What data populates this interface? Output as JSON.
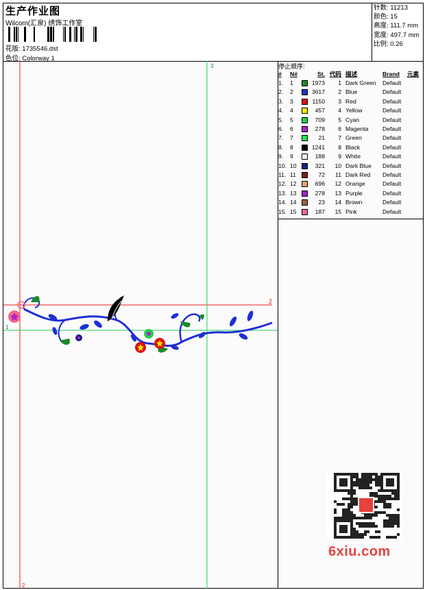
{
  "header": {
    "title": "生产作业图",
    "company": "Wilcom(汇泉) 绣饰工作室",
    "design_label": "花版:",
    "design_value": "1735546.dst",
    "colorway_label": "色位:",
    "colorway_value": "Colorway 1"
  },
  "stats": [
    {
      "label": "针数:",
      "value": "11213"
    },
    {
      "label": "颜色:",
      "value": "15"
    },
    {
      "label": "高度:",
      "value": "111.7 mm"
    },
    {
      "label": "宽度:",
      "value": "497.7 mm"
    },
    {
      "label": "比例:",
      "value": "0.26"
    }
  ],
  "canvas": {
    "marker_1": "1",
    "marker_2": "2",
    "marker_3": "3"
  },
  "color_table": {
    "title": "停止顺序:",
    "headers": {
      "idx": "#",
      "no": "N#",
      "st": "St.",
      "code": "代码",
      "desc": "描述",
      "brand": "Brand",
      "elem": "元素"
    },
    "rows": [
      {
        "idx": "1.",
        "no": "1",
        "color": "#1a8a2a",
        "st": "1973",
        "code": "1",
        "desc": "Dark Green",
        "brand": "Default"
      },
      {
        "idx": "2.",
        "no": "2",
        "color": "#1f2fd6",
        "st": "3617",
        "code": "2",
        "desc": "Blue",
        "brand": "Default"
      },
      {
        "idx": "3.",
        "no": "3",
        "color": "#e01010",
        "st": "1150",
        "code": "3",
        "desc": "Red",
        "brand": "Default"
      },
      {
        "idx": "4.",
        "no": "4",
        "color": "#f2e600",
        "st": "457",
        "code": "4",
        "desc": "Yellow",
        "brand": "Default"
      },
      {
        "idx": "5.",
        "no": "5",
        "color": "#22d04a",
        "st": "709",
        "code": "5",
        "desc": "Cyan",
        "brand": "Default"
      },
      {
        "idx": "6.",
        "no": "6",
        "color": "#b020c8",
        "st": "278",
        "code": "6",
        "desc": "Magenta",
        "brand": "Default"
      },
      {
        "idx": "7.",
        "no": "7",
        "color": "#1ee850",
        "st": "21",
        "code": "7",
        "desc": "Green",
        "brand": "Default"
      },
      {
        "idx": "8.",
        "no": "8",
        "color": "#000000",
        "st": "1241",
        "code": "8",
        "desc": "Black",
        "brand": "Default"
      },
      {
        "idx": "9.",
        "no": "9",
        "color": "#f4f4f4",
        "st": "188",
        "code": "9",
        "desc": "White",
        "brand": "Default"
      },
      {
        "idx": "10.",
        "no": "10",
        "color": "#16228a",
        "st": "321",
        "code": "10",
        "desc": "Dark Blue",
        "brand": "Default"
      },
      {
        "idx": "11.",
        "no": "11",
        "color": "#8a1a1a",
        "st": "72",
        "code": "11",
        "desc": "Dark Red",
        "brand": "Default"
      },
      {
        "idx": "12.",
        "no": "12",
        "color": "#f0a070",
        "st": "696",
        "code": "12",
        "desc": "Orange",
        "brand": "Default"
      },
      {
        "idx": "13.",
        "no": "13",
        "color": "#a020d0",
        "st": "278",
        "code": "13",
        "desc": "Purple",
        "brand": "Default"
      },
      {
        "idx": "14.",
        "no": "14",
        "color": "#9a6040",
        "st": "23",
        "code": "14",
        "desc": "Brown",
        "brand": "Default"
      },
      {
        "idx": "15.",
        "no": "15",
        "color": "#f06a8a",
        "st": "187",
        "code": "15",
        "desc": "Pink",
        "brand": "Default"
      }
    ]
  },
  "qr": {
    "icon": "qr-code-icon"
  },
  "watermark": "6xiu.com"
}
